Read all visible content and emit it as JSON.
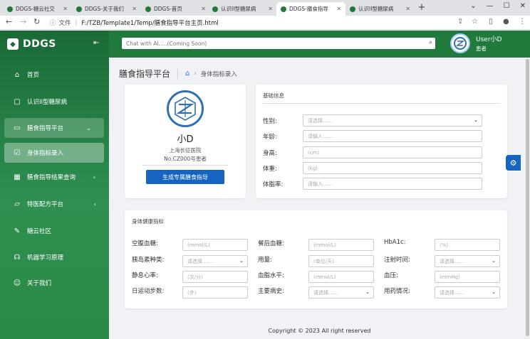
{
  "browser": {
    "tabs": [
      {
        "label": "DDGS-糖云社交",
        "active": false
      },
      {
        "label": "DDGS-关于我们",
        "active": false
      },
      {
        "label": "DDGS-首页",
        "active": false
      },
      {
        "label": "认识II型糖尿病",
        "active": false
      },
      {
        "label": "DDGS-膳食指导",
        "active": true
      },
      {
        "label": "认识II型糖尿病",
        "active": false
      }
    ],
    "url_prefix": "文件",
    "url": "F:/TZB/Template1/Temp/膳食指导平台主页.html"
  },
  "sidebar": {
    "brand": "DDGS",
    "items": [
      {
        "label": "首页",
        "icon": "home-icon"
      },
      {
        "label": "认识II型糖尿病",
        "icon": "bookmark-icon"
      },
      {
        "label": "膳食指导平台",
        "icon": "monitor-icon"
      },
      {
        "label": "身体指标录入",
        "icon": "edit-icon"
      },
      {
        "label": "膳食指导结果查询",
        "icon": "grid-icon"
      },
      {
        "label": "特医配方平台",
        "icon": "folder-icon"
      },
      {
        "label": "糖云社区",
        "icon": "edit-square-icon"
      },
      {
        "label": "机器学习原理",
        "icon": "headset-icon"
      },
      {
        "label": "关于我们",
        "icon": "user-circle-icon"
      }
    ]
  },
  "header": {
    "search_placeholder": "Chat with AI.....(Coming Soon)",
    "user_name": "User小D",
    "user_role": "患者"
  },
  "page": {
    "title": "膳食指导平台",
    "breadcrumb": "身体指标录入"
  },
  "profile": {
    "name": "小D",
    "org": "上海长征医院",
    "number": "No.CZ000号患者",
    "button": "生成专属膳食指导"
  },
  "basic_info": {
    "title": "基础信息",
    "fields": [
      {
        "label": "性别:",
        "placeholder": "请选择......",
        "type": "select"
      },
      {
        "label": "年龄:",
        "placeholder": "请输入......",
        "type": "input"
      },
      {
        "label": "身高:",
        "placeholder": "(cm)",
        "type": "input"
      },
      {
        "label": "体重:",
        "placeholder": "(kg)",
        "type": "input"
      },
      {
        "label": "体脂率:",
        "placeholder": "请输入......",
        "type": "input"
      }
    ]
  },
  "health": {
    "title": "身体健康指标",
    "fields": [
      {
        "label": "空腹血糖:",
        "placeholder": "(mmol/L)",
        "type": "input"
      },
      {
        "label": "餐后血糖:",
        "placeholder": "(mmol/L)",
        "type": "input"
      },
      {
        "label": "HbA1c:",
        "placeholder": "(%)",
        "type": "input"
      },
      {
        "label": "胰岛素种类:",
        "placeholder": "请选择......",
        "type": "select"
      },
      {
        "label": "用量:",
        "placeholder": "(单位/天)",
        "type": "input"
      },
      {
        "label": "注射时间:",
        "placeholder": "请选择......",
        "type": "select"
      },
      {
        "label": "静息心率:",
        "placeholder": "(次/分)",
        "type": "input"
      },
      {
        "label": "血脂水平:",
        "placeholder": "(mmol/L)",
        "type": "input"
      },
      {
        "label": "血压:",
        "placeholder": "(mmHg)",
        "type": "input"
      },
      {
        "label": "日运动步数:",
        "placeholder": "(步)",
        "type": "input"
      },
      {
        "label": "主要病史:",
        "placeholder": "请选择......",
        "type": "select"
      },
      {
        "label": "用药情况:",
        "placeholder": "请选择......",
        "type": "select"
      }
    ]
  },
  "footer": "Copyright © 2023 All right reserved",
  "colors": {
    "sidebar": "#1f7a3c",
    "primary": "#1565c0"
  }
}
